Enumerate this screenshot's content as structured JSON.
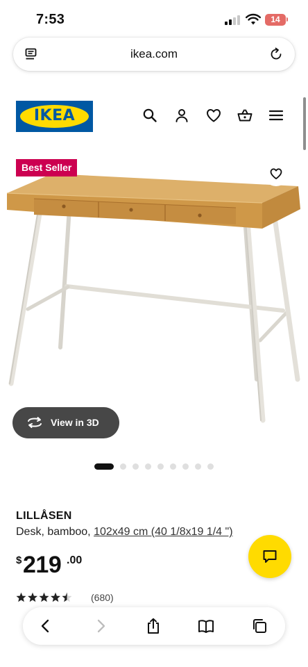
{
  "status_bar": {
    "time": "7:53",
    "battery_level": "14",
    "icons": [
      "signal-icon",
      "wifi-icon",
      "battery-icon"
    ]
  },
  "address_bar": {
    "url": "ikea.com",
    "icons": [
      "reader-icon",
      "reload-icon"
    ]
  },
  "header": {
    "logo_text": "IKEA",
    "icons": [
      "search-icon",
      "account-icon",
      "heart-icon",
      "cart-icon",
      "menu-icon"
    ]
  },
  "product": {
    "badge": "Best Seller",
    "view_3d_label": "View in 3D",
    "carousel_count": 9,
    "carousel_active": 1,
    "name": "LILLÅSEN",
    "desc_prefix": "Desk, bamboo, ",
    "size": "102x49 cm (40 1/8x19 1/4 \")",
    "price_currency": "$",
    "price_whole": "219",
    "price_cents": ".00",
    "rating": 4.5,
    "review_count": "(680)"
  },
  "toolbar": {
    "icons": [
      "back-icon",
      "forward-icon",
      "share-icon",
      "bookmarks-icon",
      "tabs-icon"
    ]
  },
  "colors": {
    "ikea_blue": "#0058a3",
    "ikea_yellow": "#ffdb00",
    "badge_red": "#cc0050",
    "view3d_bg": "#474747",
    "battery_red": "#e46b66"
  }
}
